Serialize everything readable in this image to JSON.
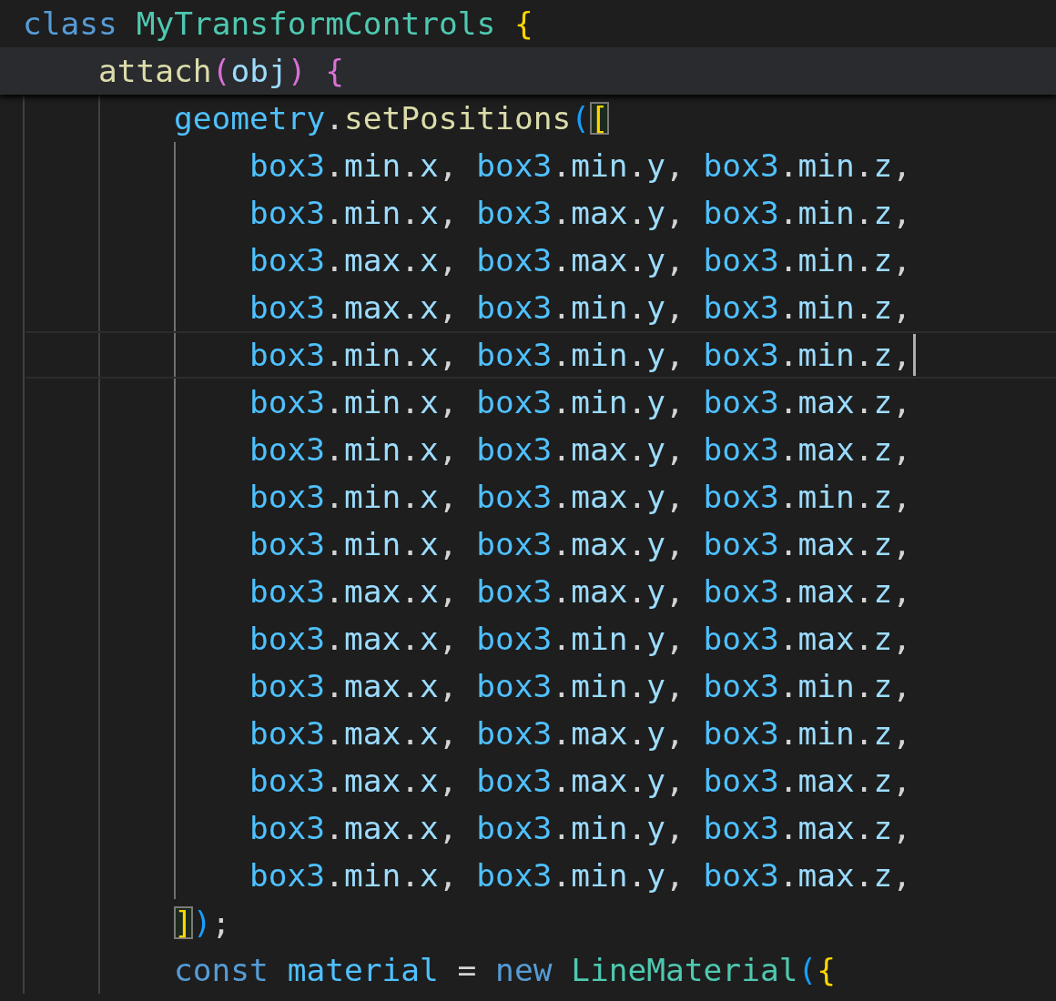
{
  "editor": {
    "sticky_scroll": [
      {
        "hovered": false,
        "tokens": [
          {
            "text": "class ",
            "kind": "keyword"
          },
          {
            "text": "MyTransformControls ",
            "kind": "class"
          },
          {
            "text": "{",
            "kind": "bracket1",
            "matched": false
          }
        ]
      },
      {
        "hovered": true,
        "tokens": [
          {
            "text": "attach",
            "kind": "function"
          },
          {
            "text": "(",
            "kind": "bracket2",
            "matched": false
          },
          {
            "text": "obj",
            "kind": "param"
          },
          {
            "text": ") ",
            "kind": "bracket2",
            "matched": false
          },
          {
            "text": "{",
            "kind": "bracket2",
            "matched": false
          }
        ]
      }
    ],
    "lines": [
      {
        "current": false,
        "cursor": false,
        "tokens": [
          {
            "text": "geometry",
            "kind": "constant"
          },
          {
            "text": ".",
            "kind": "punct"
          },
          {
            "text": "setPositions",
            "kind": "function"
          },
          {
            "text": "(",
            "kind": "bracket3",
            "matched": false
          },
          {
            "text": "[",
            "kind": "bracket1",
            "matched": true
          }
        ],
        "children": [
          {
            "current": false,
            "cursor": false,
            "tokens": [
              {
                "text": "box3",
                "kind": "constant"
              },
              {
                "text": ".",
                "kind": "punct"
              },
              {
                "text": "min",
                "kind": "param"
              },
              {
                "text": ".",
                "kind": "punct"
              },
              {
                "text": "x",
                "kind": "param"
              },
              {
                "text": ", ",
                "kind": "punct"
              },
              {
                "text": "box3",
                "kind": "constant"
              },
              {
                "text": ".",
                "kind": "punct"
              },
              {
                "text": "min",
                "kind": "param"
              },
              {
                "text": ".",
                "kind": "punct"
              },
              {
                "text": "y",
                "kind": "param"
              },
              {
                "text": ", ",
                "kind": "punct"
              },
              {
                "text": "box3",
                "kind": "constant"
              },
              {
                "text": ".",
                "kind": "punct"
              },
              {
                "text": "min",
                "kind": "param"
              },
              {
                "text": ".",
                "kind": "punct"
              },
              {
                "text": "z",
                "kind": "param"
              },
              {
                "text": ",",
                "kind": "punct"
              }
            ]
          },
          {
            "current": false,
            "cursor": false,
            "tokens": [
              {
                "text": "box3",
                "kind": "constant"
              },
              {
                "text": ".",
                "kind": "punct"
              },
              {
                "text": "min",
                "kind": "param"
              },
              {
                "text": ".",
                "kind": "punct"
              },
              {
                "text": "x",
                "kind": "param"
              },
              {
                "text": ", ",
                "kind": "punct"
              },
              {
                "text": "box3",
                "kind": "constant"
              },
              {
                "text": ".",
                "kind": "punct"
              },
              {
                "text": "max",
                "kind": "param"
              },
              {
                "text": ".",
                "kind": "punct"
              },
              {
                "text": "y",
                "kind": "param"
              },
              {
                "text": ", ",
                "kind": "punct"
              },
              {
                "text": "box3",
                "kind": "constant"
              },
              {
                "text": ".",
                "kind": "punct"
              },
              {
                "text": "min",
                "kind": "param"
              },
              {
                "text": ".",
                "kind": "punct"
              },
              {
                "text": "z",
                "kind": "param"
              },
              {
                "text": ",",
                "kind": "punct"
              }
            ]
          },
          {
            "current": false,
            "cursor": false,
            "tokens": [
              {
                "text": "box3",
                "kind": "constant"
              },
              {
                "text": ".",
                "kind": "punct"
              },
              {
                "text": "max",
                "kind": "param"
              },
              {
                "text": ".",
                "kind": "punct"
              },
              {
                "text": "x",
                "kind": "param"
              },
              {
                "text": ", ",
                "kind": "punct"
              },
              {
                "text": "box3",
                "kind": "constant"
              },
              {
                "text": ".",
                "kind": "punct"
              },
              {
                "text": "max",
                "kind": "param"
              },
              {
                "text": ".",
                "kind": "punct"
              },
              {
                "text": "y",
                "kind": "param"
              },
              {
                "text": ", ",
                "kind": "punct"
              },
              {
                "text": "box3",
                "kind": "constant"
              },
              {
                "text": ".",
                "kind": "punct"
              },
              {
                "text": "min",
                "kind": "param"
              },
              {
                "text": ".",
                "kind": "punct"
              },
              {
                "text": "z",
                "kind": "param"
              },
              {
                "text": ",",
                "kind": "punct"
              }
            ]
          },
          {
            "current": false,
            "cursor": false,
            "tokens": [
              {
                "text": "box3",
                "kind": "constant"
              },
              {
                "text": ".",
                "kind": "punct"
              },
              {
                "text": "max",
                "kind": "param"
              },
              {
                "text": ".",
                "kind": "punct"
              },
              {
                "text": "x",
                "kind": "param"
              },
              {
                "text": ", ",
                "kind": "punct"
              },
              {
                "text": "box3",
                "kind": "constant"
              },
              {
                "text": ".",
                "kind": "punct"
              },
              {
                "text": "min",
                "kind": "param"
              },
              {
                "text": ".",
                "kind": "punct"
              },
              {
                "text": "y",
                "kind": "param"
              },
              {
                "text": ", ",
                "kind": "punct"
              },
              {
                "text": "box3",
                "kind": "constant"
              },
              {
                "text": ".",
                "kind": "punct"
              },
              {
                "text": "min",
                "kind": "param"
              },
              {
                "text": ".",
                "kind": "punct"
              },
              {
                "text": "z",
                "kind": "param"
              },
              {
                "text": ",",
                "kind": "punct"
              }
            ]
          },
          {
            "current": true,
            "cursor": true,
            "tokens": [
              {
                "text": "box3",
                "kind": "constant"
              },
              {
                "text": ".",
                "kind": "punct"
              },
              {
                "text": "min",
                "kind": "param"
              },
              {
                "text": ".",
                "kind": "punct"
              },
              {
                "text": "x",
                "kind": "param"
              },
              {
                "text": ", ",
                "kind": "punct"
              },
              {
                "text": "box3",
                "kind": "constant"
              },
              {
                "text": ".",
                "kind": "punct"
              },
              {
                "text": "min",
                "kind": "param"
              },
              {
                "text": ".",
                "kind": "punct"
              },
              {
                "text": "y",
                "kind": "param"
              },
              {
                "text": ", ",
                "kind": "punct"
              },
              {
                "text": "box3",
                "kind": "constant"
              },
              {
                "text": ".",
                "kind": "punct"
              },
              {
                "text": "min",
                "kind": "param"
              },
              {
                "text": ".",
                "kind": "punct"
              },
              {
                "text": "z",
                "kind": "param"
              },
              {
                "text": ",",
                "kind": "punct"
              }
            ]
          },
          {
            "current": false,
            "cursor": false,
            "tokens": [
              {
                "text": "box3",
                "kind": "constant"
              },
              {
                "text": ".",
                "kind": "punct"
              },
              {
                "text": "min",
                "kind": "param"
              },
              {
                "text": ".",
                "kind": "punct"
              },
              {
                "text": "x",
                "kind": "param"
              },
              {
                "text": ", ",
                "kind": "punct"
              },
              {
                "text": "box3",
                "kind": "constant"
              },
              {
                "text": ".",
                "kind": "punct"
              },
              {
                "text": "min",
                "kind": "param"
              },
              {
                "text": ".",
                "kind": "punct"
              },
              {
                "text": "y",
                "kind": "param"
              },
              {
                "text": ", ",
                "kind": "punct"
              },
              {
                "text": "box3",
                "kind": "constant"
              },
              {
                "text": ".",
                "kind": "punct"
              },
              {
                "text": "max",
                "kind": "param"
              },
              {
                "text": ".",
                "kind": "punct"
              },
              {
                "text": "z",
                "kind": "param"
              },
              {
                "text": ",",
                "kind": "punct"
              }
            ]
          },
          {
            "current": false,
            "cursor": false,
            "tokens": [
              {
                "text": "box3",
                "kind": "constant"
              },
              {
                "text": ".",
                "kind": "punct"
              },
              {
                "text": "min",
                "kind": "param"
              },
              {
                "text": ".",
                "kind": "punct"
              },
              {
                "text": "x",
                "kind": "param"
              },
              {
                "text": ", ",
                "kind": "punct"
              },
              {
                "text": "box3",
                "kind": "constant"
              },
              {
                "text": ".",
                "kind": "punct"
              },
              {
                "text": "max",
                "kind": "param"
              },
              {
                "text": ".",
                "kind": "punct"
              },
              {
                "text": "y",
                "kind": "param"
              },
              {
                "text": ", ",
                "kind": "punct"
              },
              {
                "text": "box3",
                "kind": "constant"
              },
              {
                "text": ".",
                "kind": "punct"
              },
              {
                "text": "max",
                "kind": "param"
              },
              {
                "text": ".",
                "kind": "punct"
              },
              {
                "text": "z",
                "kind": "param"
              },
              {
                "text": ",",
                "kind": "punct"
              }
            ]
          },
          {
            "current": false,
            "cursor": false,
            "tokens": [
              {
                "text": "box3",
                "kind": "constant"
              },
              {
                "text": ".",
                "kind": "punct"
              },
              {
                "text": "min",
                "kind": "param"
              },
              {
                "text": ".",
                "kind": "punct"
              },
              {
                "text": "x",
                "kind": "param"
              },
              {
                "text": ", ",
                "kind": "punct"
              },
              {
                "text": "box3",
                "kind": "constant"
              },
              {
                "text": ".",
                "kind": "punct"
              },
              {
                "text": "max",
                "kind": "param"
              },
              {
                "text": ".",
                "kind": "punct"
              },
              {
                "text": "y",
                "kind": "param"
              },
              {
                "text": ", ",
                "kind": "punct"
              },
              {
                "text": "box3",
                "kind": "constant"
              },
              {
                "text": ".",
                "kind": "punct"
              },
              {
                "text": "min",
                "kind": "param"
              },
              {
                "text": ".",
                "kind": "punct"
              },
              {
                "text": "z",
                "kind": "param"
              },
              {
                "text": ",",
                "kind": "punct"
              }
            ]
          },
          {
            "current": false,
            "cursor": false,
            "tokens": [
              {
                "text": "box3",
                "kind": "constant"
              },
              {
                "text": ".",
                "kind": "punct"
              },
              {
                "text": "min",
                "kind": "param"
              },
              {
                "text": ".",
                "kind": "punct"
              },
              {
                "text": "x",
                "kind": "param"
              },
              {
                "text": ", ",
                "kind": "punct"
              },
              {
                "text": "box3",
                "kind": "constant"
              },
              {
                "text": ".",
                "kind": "punct"
              },
              {
                "text": "max",
                "kind": "param"
              },
              {
                "text": ".",
                "kind": "punct"
              },
              {
                "text": "y",
                "kind": "param"
              },
              {
                "text": ", ",
                "kind": "punct"
              },
              {
                "text": "box3",
                "kind": "constant"
              },
              {
                "text": ".",
                "kind": "punct"
              },
              {
                "text": "max",
                "kind": "param"
              },
              {
                "text": ".",
                "kind": "punct"
              },
              {
                "text": "z",
                "kind": "param"
              },
              {
                "text": ",",
                "kind": "punct"
              }
            ]
          },
          {
            "current": false,
            "cursor": false,
            "tokens": [
              {
                "text": "box3",
                "kind": "constant"
              },
              {
                "text": ".",
                "kind": "punct"
              },
              {
                "text": "max",
                "kind": "param"
              },
              {
                "text": ".",
                "kind": "punct"
              },
              {
                "text": "x",
                "kind": "param"
              },
              {
                "text": ", ",
                "kind": "punct"
              },
              {
                "text": "box3",
                "kind": "constant"
              },
              {
                "text": ".",
                "kind": "punct"
              },
              {
                "text": "max",
                "kind": "param"
              },
              {
                "text": ".",
                "kind": "punct"
              },
              {
                "text": "y",
                "kind": "param"
              },
              {
                "text": ", ",
                "kind": "punct"
              },
              {
                "text": "box3",
                "kind": "constant"
              },
              {
                "text": ".",
                "kind": "punct"
              },
              {
                "text": "max",
                "kind": "param"
              },
              {
                "text": ".",
                "kind": "punct"
              },
              {
                "text": "z",
                "kind": "param"
              },
              {
                "text": ",",
                "kind": "punct"
              }
            ]
          },
          {
            "current": false,
            "cursor": false,
            "tokens": [
              {
                "text": "box3",
                "kind": "constant"
              },
              {
                "text": ".",
                "kind": "punct"
              },
              {
                "text": "max",
                "kind": "param"
              },
              {
                "text": ".",
                "kind": "punct"
              },
              {
                "text": "x",
                "kind": "param"
              },
              {
                "text": ", ",
                "kind": "punct"
              },
              {
                "text": "box3",
                "kind": "constant"
              },
              {
                "text": ".",
                "kind": "punct"
              },
              {
                "text": "min",
                "kind": "param"
              },
              {
                "text": ".",
                "kind": "punct"
              },
              {
                "text": "y",
                "kind": "param"
              },
              {
                "text": ", ",
                "kind": "punct"
              },
              {
                "text": "box3",
                "kind": "constant"
              },
              {
                "text": ".",
                "kind": "punct"
              },
              {
                "text": "max",
                "kind": "param"
              },
              {
                "text": ".",
                "kind": "punct"
              },
              {
                "text": "z",
                "kind": "param"
              },
              {
                "text": ",",
                "kind": "punct"
              }
            ]
          },
          {
            "current": false,
            "cursor": false,
            "tokens": [
              {
                "text": "box3",
                "kind": "constant"
              },
              {
                "text": ".",
                "kind": "punct"
              },
              {
                "text": "max",
                "kind": "param"
              },
              {
                "text": ".",
                "kind": "punct"
              },
              {
                "text": "x",
                "kind": "param"
              },
              {
                "text": ", ",
                "kind": "punct"
              },
              {
                "text": "box3",
                "kind": "constant"
              },
              {
                "text": ".",
                "kind": "punct"
              },
              {
                "text": "min",
                "kind": "param"
              },
              {
                "text": ".",
                "kind": "punct"
              },
              {
                "text": "y",
                "kind": "param"
              },
              {
                "text": ", ",
                "kind": "punct"
              },
              {
                "text": "box3",
                "kind": "constant"
              },
              {
                "text": ".",
                "kind": "punct"
              },
              {
                "text": "min",
                "kind": "param"
              },
              {
                "text": ".",
                "kind": "punct"
              },
              {
                "text": "z",
                "kind": "param"
              },
              {
                "text": ",",
                "kind": "punct"
              }
            ]
          },
          {
            "current": false,
            "cursor": false,
            "tokens": [
              {
                "text": "box3",
                "kind": "constant"
              },
              {
                "text": ".",
                "kind": "punct"
              },
              {
                "text": "max",
                "kind": "param"
              },
              {
                "text": ".",
                "kind": "punct"
              },
              {
                "text": "x",
                "kind": "param"
              },
              {
                "text": ", ",
                "kind": "punct"
              },
              {
                "text": "box3",
                "kind": "constant"
              },
              {
                "text": ".",
                "kind": "punct"
              },
              {
                "text": "max",
                "kind": "param"
              },
              {
                "text": ".",
                "kind": "punct"
              },
              {
                "text": "y",
                "kind": "param"
              },
              {
                "text": ", ",
                "kind": "punct"
              },
              {
                "text": "box3",
                "kind": "constant"
              },
              {
                "text": ".",
                "kind": "punct"
              },
              {
                "text": "min",
                "kind": "param"
              },
              {
                "text": ".",
                "kind": "punct"
              },
              {
                "text": "z",
                "kind": "param"
              },
              {
                "text": ",",
                "kind": "punct"
              }
            ]
          },
          {
            "current": false,
            "cursor": false,
            "tokens": [
              {
                "text": "box3",
                "kind": "constant"
              },
              {
                "text": ".",
                "kind": "punct"
              },
              {
                "text": "max",
                "kind": "param"
              },
              {
                "text": ".",
                "kind": "punct"
              },
              {
                "text": "x",
                "kind": "param"
              },
              {
                "text": ", ",
                "kind": "punct"
              },
              {
                "text": "box3",
                "kind": "constant"
              },
              {
                "text": ".",
                "kind": "punct"
              },
              {
                "text": "max",
                "kind": "param"
              },
              {
                "text": ".",
                "kind": "punct"
              },
              {
                "text": "y",
                "kind": "param"
              },
              {
                "text": ", ",
                "kind": "punct"
              },
              {
                "text": "box3",
                "kind": "constant"
              },
              {
                "text": ".",
                "kind": "punct"
              },
              {
                "text": "max",
                "kind": "param"
              },
              {
                "text": ".",
                "kind": "punct"
              },
              {
                "text": "z",
                "kind": "param"
              },
              {
                "text": ",",
                "kind": "punct"
              }
            ]
          },
          {
            "current": false,
            "cursor": false,
            "tokens": [
              {
                "text": "box3",
                "kind": "constant"
              },
              {
                "text": ".",
                "kind": "punct"
              },
              {
                "text": "max",
                "kind": "param"
              },
              {
                "text": ".",
                "kind": "punct"
              },
              {
                "text": "x",
                "kind": "param"
              },
              {
                "text": ", ",
                "kind": "punct"
              },
              {
                "text": "box3",
                "kind": "constant"
              },
              {
                "text": ".",
                "kind": "punct"
              },
              {
                "text": "min",
                "kind": "param"
              },
              {
                "text": ".",
                "kind": "punct"
              },
              {
                "text": "y",
                "kind": "param"
              },
              {
                "text": ", ",
                "kind": "punct"
              },
              {
                "text": "box3",
                "kind": "constant"
              },
              {
                "text": ".",
                "kind": "punct"
              },
              {
                "text": "max",
                "kind": "param"
              },
              {
                "text": ".",
                "kind": "punct"
              },
              {
                "text": "z",
                "kind": "param"
              },
              {
                "text": ",",
                "kind": "punct"
              }
            ]
          },
          {
            "current": false,
            "cursor": false,
            "tokens": [
              {
                "text": "box3",
                "kind": "constant"
              },
              {
                "text": ".",
                "kind": "punct"
              },
              {
                "text": "min",
                "kind": "param"
              },
              {
                "text": ".",
                "kind": "punct"
              },
              {
                "text": "x",
                "kind": "param"
              },
              {
                "text": ", ",
                "kind": "punct"
              },
              {
                "text": "box3",
                "kind": "constant"
              },
              {
                "text": ".",
                "kind": "punct"
              },
              {
                "text": "min",
                "kind": "param"
              },
              {
                "text": ".",
                "kind": "punct"
              },
              {
                "text": "y",
                "kind": "param"
              },
              {
                "text": ", ",
                "kind": "punct"
              },
              {
                "text": "box3",
                "kind": "constant"
              },
              {
                "text": ".",
                "kind": "punct"
              },
              {
                "text": "max",
                "kind": "param"
              },
              {
                "text": ".",
                "kind": "punct"
              },
              {
                "text": "z",
                "kind": "param"
              },
              {
                "text": ",",
                "kind": "punct"
              }
            ]
          }
        ]
      },
      {
        "current": false,
        "cursor": false,
        "tokens": [
          {
            "text": "]",
            "kind": "bracket1",
            "matched": true
          },
          {
            "text": ")",
            "kind": "bracket3",
            "matched": false
          },
          {
            "text": ";",
            "kind": "punct"
          }
        ]
      },
      {
        "current": false,
        "cursor": false,
        "tokens": [
          {
            "text": "const ",
            "kind": "keyword"
          },
          {
            "text": "material ",
            "kind": "constant"
          },
          {
            "text": "= ",
            "kind": "punct"
          },
          {
            "text": "new ",
            "kind": "keyword"
          },
          {
            "text": "LineMaterial",
            "kind": "class"
          },
          {
            "text": "(",
            "kind": "bracket3",
            "matched": false
          },
          {
            "text": "{",
            "kind": "bracket1",
            "matched": false
          }
        ]
      }
    ]
  }
}
